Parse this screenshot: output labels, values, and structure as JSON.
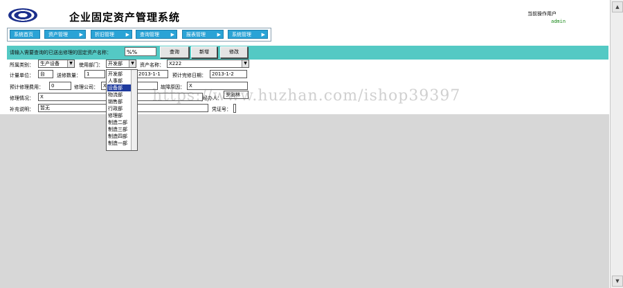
{
  "header": {
    "title": "企业固定资产管理系统",
    "operator_label": "当前操作用户",
    "operator_user": "admin"
  },
  "nav": {
    "items": [
      {
        "label": "系统首页",
        "arrow": false
      },
      {
        "label": "资产管理",
        "arrow": true
      },
      {
        "label": "折旧管理",
        "arrow": true
      },
      {
        "label": "查询管理",
        "arrow": true
      },
      {
        "label": "报表管理",
        "arrow": true
      },
      {
        "label": "系统管理",
        "arrow": true
      }
    ]
  },
  "query": {
    "prompt": "请输入需要查询的已送出修理的固定资产名称：",
    "input_value": "%%",
    "buttons": {
      "search": "查询",
      "add": "新增",
      "edit": "修改"
    }
  },
  "form": {
    "category_label": "所属类别：",
    "category_value": "生产设备",
    "dept_label": "使用部门：",
    "dept_value": "开发部",
    "asset_label": "资产名称：",
    "asset_value": "X222",
    "unit_label": "计量单位：",
    "unit_value": "台",
    "qty_label": "送修数量：",
    "qty_value": "1",
    "send_date_value": "2013-1-1",
    "plan_date_label": "预计完修日期：",
    "plan_date_value": "2013-1-2",
    "cost_label": "预计修理费用：",
    "cost_value": "0",
    "company_label": "修理公司：",
    "company_value": "X",
    "reason_label": "故障原因：",
    "reason_value": "X",
    "status_label": "修理情况：",
    "status_value": "X",
    "handler_label": "经办人：",
    "handler_value": "罗刚林",
    "remark_label": "补充说明：",
    "remark_value": "暂无",
    "docno_label": "凭证号："
  },
  "dept_dropdown": {
    "options": [
      "开发部",
      "人事部",
      "设备部",
      "物流部",
      "销售部",
      "行政部",
      "修理部",
      "制造二部",
      "制造三部",
      "制造四部",
      "制造一部"
    ],
    "selected_index": 2
  },
  "watermark": "https://www.huzhan.com/ishop39397"
}
